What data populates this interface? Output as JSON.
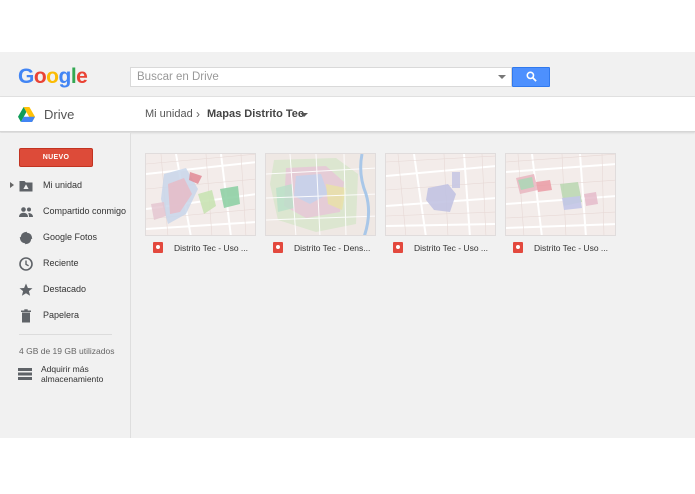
{
  "header": {
    "logo_letters": [
      {
        "ch": "G",
        "color": "#4285F4"
      },
      {
        "ch": "o",
        "color": "#EA4335"
      },
      {
        "ch": "o",
        "color": "#FBBC05"
      },
      {
        "ch": "g",
        "color": "#4285F4"
      },
      {
        "ch": "l",
        "color": "#34A853"
      },
      {
        "ch": "e",
        "color": "#EA4335"
      }
    ],
    "search_placeholder": "Buscar en Drive",
    "search_button_color": "#4d90fe"
  },
  "drivebar": {
    "title": "Drive",
    "breadcrumb_root": "Mi unidad",
    "breadcrumb_separator": "›",
    "breadcrumb_current": "Mapas Distrito Tec"
  },
  "sidebar": {
    "new_label": "NUEVO",
    "new_color": "#dd4b39",
    "items": [
      {
        "label": "Mi unidad",
        "icon": "folder-drive-icon"
      },
      {
        "label": "Compartido conmigo",
        "icon": "people-icon"
      },
      {
        "label": "Google Fotos",
        "icon": "pinwheel-icon"
      },
      {
        "label": "Reciente",
        "icon": "clock-icon"
      },
      {
        "label": "Destacado",
        "icon": "star-icon"
      },
      {
        "label": "Papelera",
        "icon": "trash-icon"
      }
    ],
    "storage_text": "4 GB de 19 GB utilizados",
    "buy_storage": "Adquirir más almacenamiento"
  },
  "files": [
    {
      "name": "Distrito Tec - Uso ...",
      "icon": "my-maps-icon"
    },
    {
      "name": "Distrito Tec - Dens...",
      "icon": "my-maps-icon"
    },
    {
      "name": "Distrito Tec - Uso ...",
      "icon": "my-maps-icon"
    },
    {
      "name": "Distrito Tec - Uso ...",
      "icon": "my-maps-icon"
    }
  ]
}
